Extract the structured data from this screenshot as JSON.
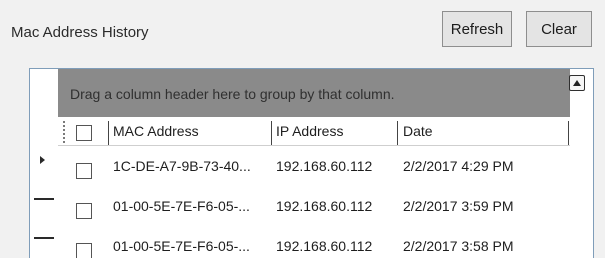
{
  "panel": {
    "title": "Mac Address History",
    "refresh_label": "Refresh",
    "clear_label": "Clear"
  },
  "grid": {
    "group_hint": "Drag a column header here to group by that column.",
    "columns": [
      "MAC Address",
      "IP Address",
      "Date"
    ],
    "rows": [
      {
        "mac": "1C-DE-A7-9B-73-40...",
        "ip": "192.168.60.112",
        "date": "2/2/2017 4:29 PM"
      },
      {
        "mac": "01-00-5E-7E-F6-05-...",
        "ip": "192.168.60.112",
        "date": "2/2/2017 3:59 PM"
      },
      {
        "mac": "01-00-5E-7E-F6-05-...",
        "ip": "192.168.60.112",
        "date": "2/2/2017 3:58 PM"
      }
    ]
  },
  "icons": {
    "scroll_up": "chevron-up-icon",
    "current_row": "row-pointer-icon"
  }
}
